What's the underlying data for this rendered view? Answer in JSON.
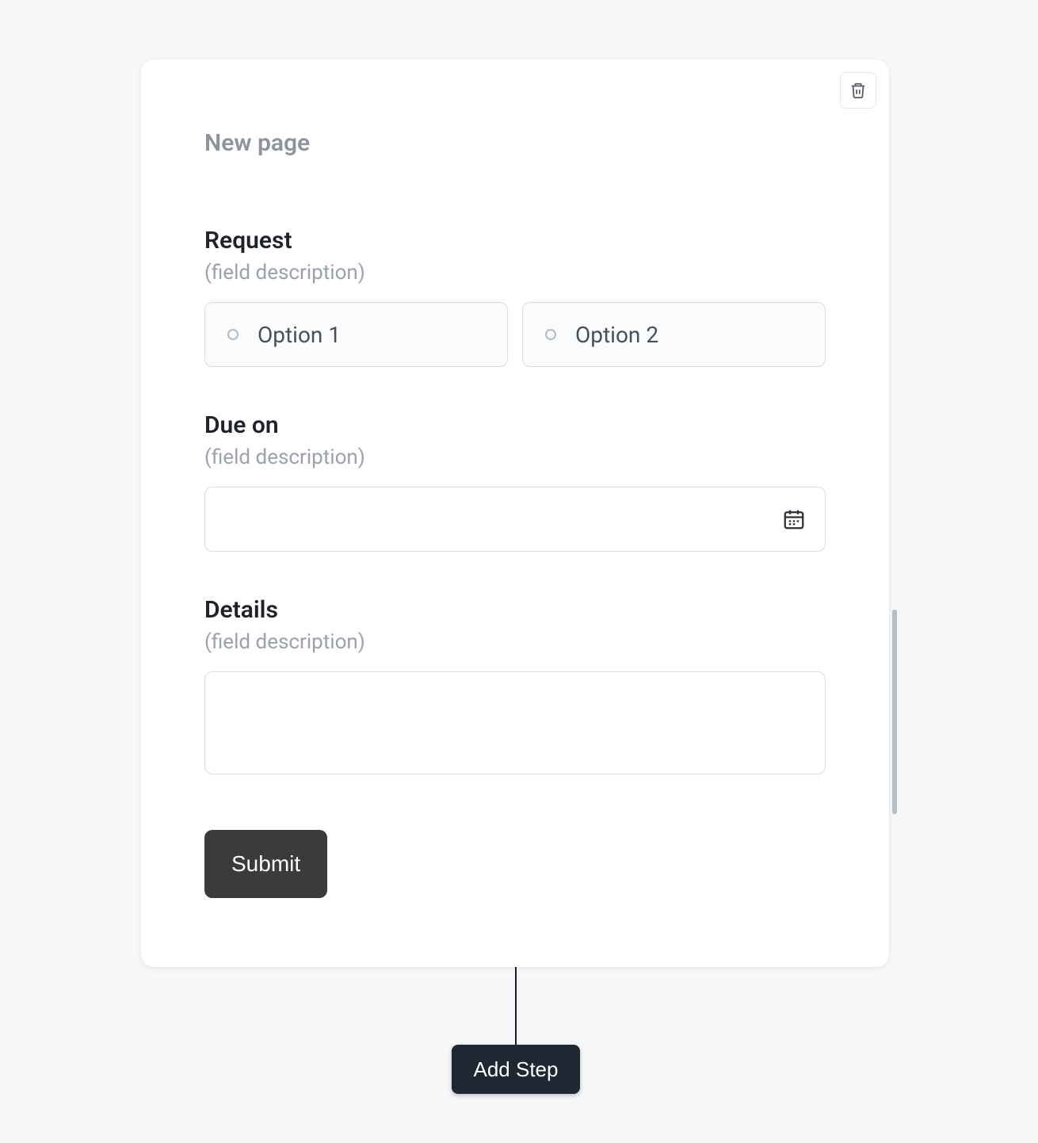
{
  "page_title": "New page",
  "fields": {
    "request": {
      "label": "Request",
      "description": "(field description)",
      "options": [
        {
          "label": "Option 1"
        },
        {
          "label": "Option 2"
        }
      ]
    },
    "due_on": {
      "label": "Due on",
      "description": "(field description)",
      "value": ""
    },
    "details": {
      "label": "Details",
      "description": "(field description)",
      "value": ""
    }
  },
  "submit_label": "Submit",
  "add_step_label": "Add Step"
}
